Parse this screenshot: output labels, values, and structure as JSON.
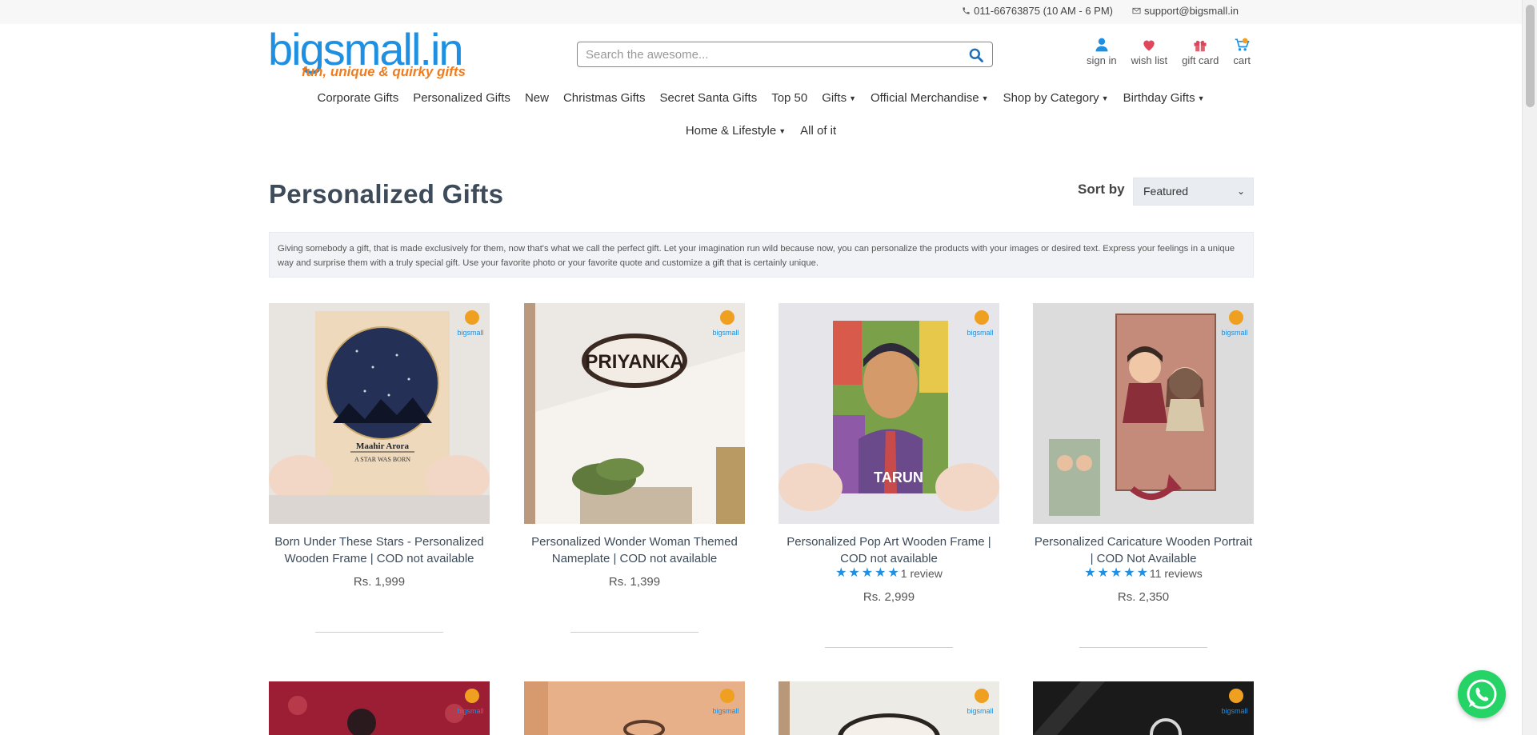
{
  "topbar": {
    "phone": "011-66763875 (10 AM - 6 PM)",
    "email": "support@bigsmall.in"
  },
  "logo": {
    "main": "bigsmall.in",
    "tagline": "fun, unique & quirky gifts"
  },
  "search": {
    "placeholder": "Search the awesome..."
  },
  "header_icons": [
    {
      "label": "sign in",
      "icon": "user-icon"
    },
    {
      "label": "wish list",
      "icon": "heart-icon"
    },
    {
      "label": "gift card",
      "icon": "gift-icon"
    },
    {
      "label": "cart",
      "icon": "cart-icon"
    }
  ],
  "nav": {
    "row1": [
      {
        "label": "Corporate Gifts",
        "dropdown": false
      },
      {
        "label": "Personalized Gifts",
        "dropdown": false
      },
      {
        "label": "New",
        "dropdown": false
      },
      {
        "label": "Christmas Gifts",
        "dropdown": false
      },
      {
        "label": "Secret Santa Gifts",
        "dropdown": false
      },
      {
        "label": "Top 50",
        "dropdown": false
      },
      {
        "label": "Gifts",
        "dropdown": true
      },
      {
        "label": "Official Merchandise",
        "dropdown": true
      },
      {
        "label": "Shop by Category",
        "dropdown": true
      },
      {
        "label": "Birthday Gifts",
        "dropdown": true
      }
    ],
    "row2": [
      {
        "label": "Home & Lifestyle",
        "dropdown": true
      },
      {
        "label": "All of it",
        "dropdown": false
      }
    ]
  },
  "page": {
    "title": "Personalized Gifts",
    "sort_label": "Sort by",
    "sort_value": "Featured",
    "description": "Giving somebody a gift, that is made exclusively for them, now that's what we call the perfect gift. Let your imagination run wild because now, you can personalize the products with your images or desired text. Express your feelings in a unique way and surprise them with a truly special gift. Use your favorite photo or your favorite quote and customize a gift that is certainly unique."
  },
  "products": [
    {
      "title": "Born Under These Stars - Personalized Wooden Frame | COD not available",
      "price": "Rs. 1,999",
      "rating_stars": 0,
      "reviews": "",
      "image_text_1": "Maahir Arora",
      "image_text_2": "A STAR WAS BORN"
    },
    {
      "title": "Personalized Wonder Woman Themed Nameplate | COD not available",
      "price": "Rs. 1,399",
      "rating_stars": 0,
      "reviews": "",
      "image_text_1": "PRIYANKA",
      "image_text_2": ""
    },
    {
      "title": "Personalized Pop Art Wooden Frame | COD not available",
      "price": "Rs. 2,999",
      "rating_stars": 5,
      "reviews": "1 review",
      "image_text_1": "TARUN",
      "image_text_2": ""
    },
    {
      "title": "Personalized Caricature Wooden Portrait | COD Not Available",
      "price": "Rs. 2,350",
      "rating_stars": 5,
      "reviews": "11 reviews",
      "image_text_1": "",
      "image_text_2": ""
    }
  ],
  "colors": {
    "brand_blue": "#1e8fe1",
    "brand_orange": "#f07c1e",
    "whatsapp_green": "#25d366"
  }
}
